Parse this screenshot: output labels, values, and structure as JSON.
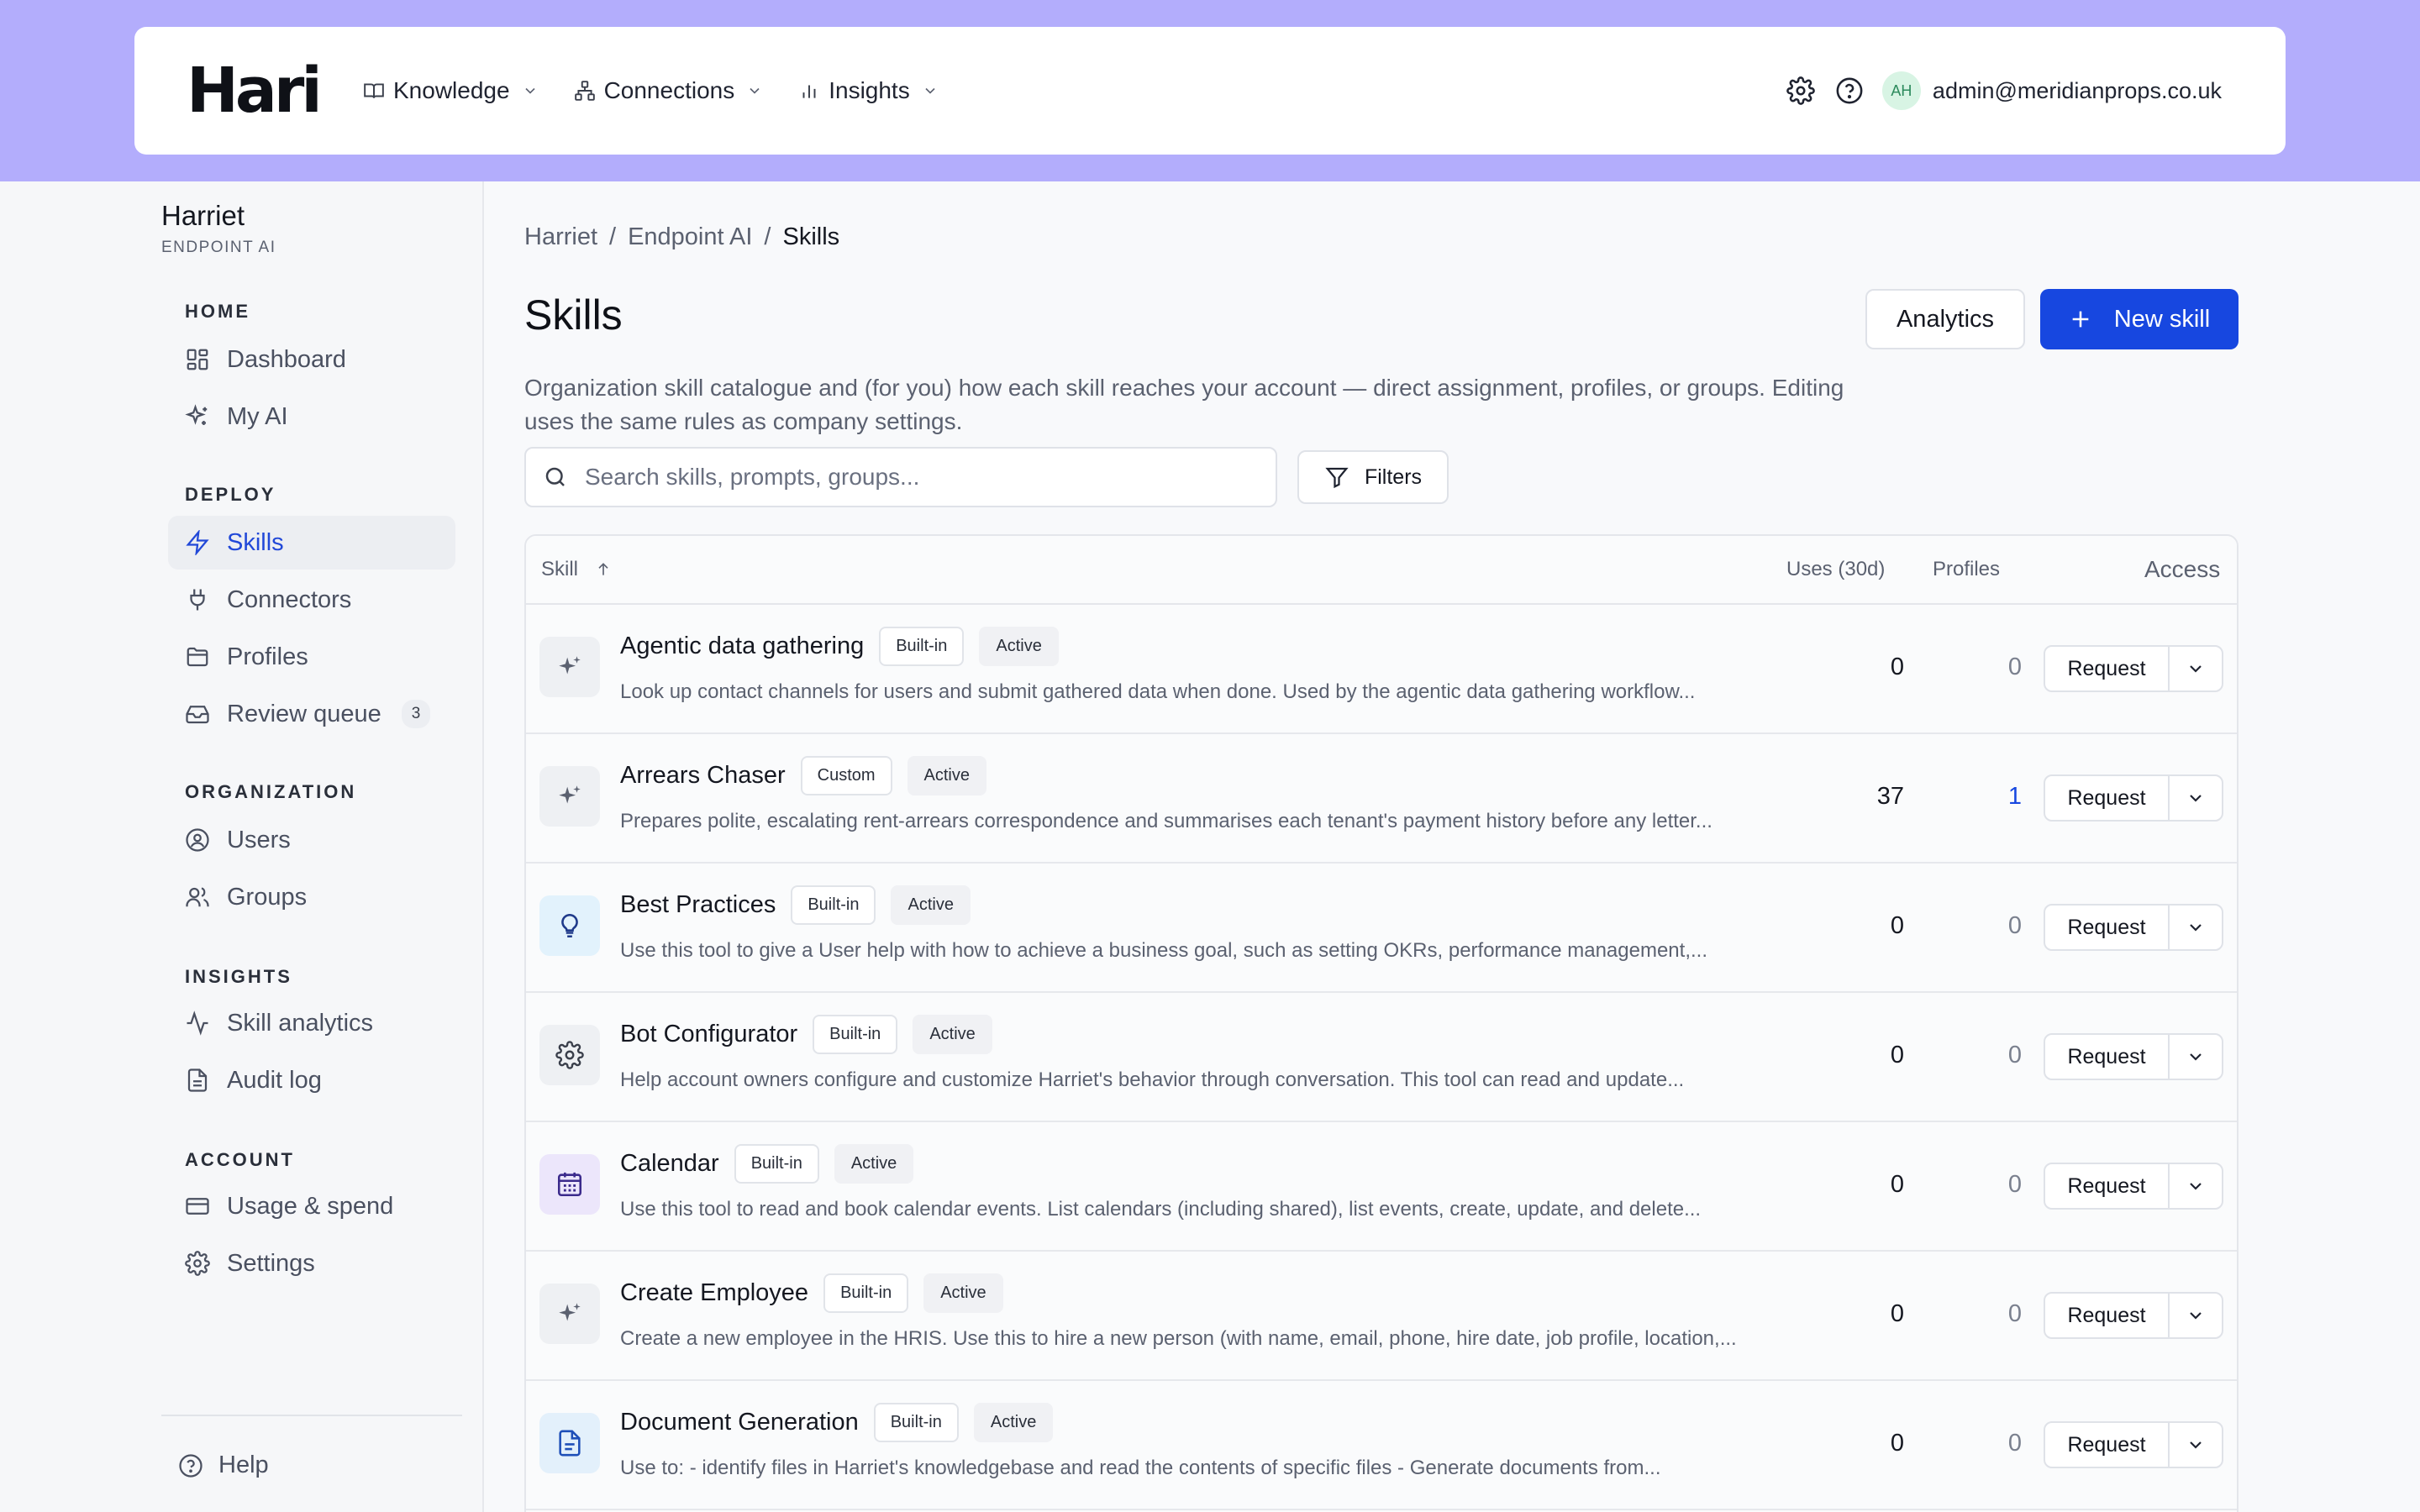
{
  "header": {
    "logo": "Hari",
    "nav": [
      {
        "label": "Knowledge",
        "icon": "book-icon"
      },
      {
        "label": "Connections",
        "icon": "network-icon"
      },
      {
        "label": "Insights",
        "icon": "bar-chart-icon"
      }
    ],
    "user": {
      "initials": "AH",
      "email": "admin@meridianprops.co.uk"
    }
  },
  "sidebar": {
    "org_name": "Harriet",
    "org_sub": "ENDPOINT AI",
    "sections": {
      "home": "HOME",
      "deploy": "DEPLOY",
      "organization": "ORGANIZATION",
      "insights": "INSIGHTS",
      "account": "ACCOUNT"
    },
    "items": {
      "dashboard": "Dashboard",
      "my_ai": "My AI",
      "skills": "Skills",
      "connectors": "Connectors",
      "profiles": "Profiles",
      "review_queue": "Review queue",
      "review_queue_count": "3",
      "users": "Users",
      "groups": "Groups",
      "skill_analytics": "Skill analytics",
      "audit_log": "Audit log",
      "usage_spend": "Usage & spend",
      "settings": "Settings"
    },
    "help": "Help"
  },
  "breadcrumb": [
    "Harriet",
    "Endpoint AI",
    "Skills"
  ],
  "page": {
    "title": "Skills",
    "analytics_label": "Analytics",
    "new_skill_label": "New skill",
    "description": "Organization skill catalogue and (for you) how each skill reaches your account — direct assignment, profiles, or groups. Editing uses the same rules as company settings.",
    "search_placeholder": "Search skills, prompts, groups...",
    "filters_label": "Filters"
  },
  "table": {
    "columns": {
      "skill": "Skill",
      "uses": "Uses (30d)",
      "profiles": "Profiles",
      "access": "Access"
    },
    "request_label": "Request",
    "rows": [
      {
        "icon": "sparkle-icon",
        "name": "Agentic data gathering",
        "type": "Built-in",
        "status": "Active",
        "desc": "Look up contact channels for users and submit gathered data when done. Used by the agentic data gathering workflow...",
        "uses": "0",
        "profiles": "0"
      },
      {
        "icon": "sparkle-icon",
        "name": "Arrears Chaser",
        "type": "Custom",
        "status": "Active",
        "desc": "Prepares polite, escalating rent-arrears correspondence and summarises each tenant's payment history before any letter...",
        "uses": "37",
        "profiles": "1"
      },
      {
        "icon": "lightbulb-icon",
        "name": "Best Practices",
        "type": "Built-in",
        "status": "Active",
        "desc": "Use this tool to give a User help with how to achieve a business goal, such as setting OKRs, performance management,...",
        "uses": "0",
        "profiles": "0"
      },
      {
        "icon": "gear-icon",
        "name": "Bot Configurator",
        "type": "Built-in",
        "status": "Active",
        "desc": "Help account owners configure and customize Harriet's behavior through conversation. This tool can read and update...",
        "uses": "0",
        "profiles": "0"
      },
      {
        "icon": "calendar-icon",
        "name": "Calendar",
        "type": "Built-in",
        "status": "Active",
        "desc": "Use this tool to read and book calendar events. List calendars (including shared), list events, create, update, and delete...",
        "uses": "0",
        "profiles": "0"
      },
      {
        "icon": "sparkle-icon",
        "name": "Create Employee",
        "type": "Built-in",
        "status": "Active",
        "desc": "Create a new employee in the HRIS. Use this to hire a new person (with name, email, phone, hire date, job profile, location,...",
        "uses": "0",
        "profiles": "0"
      },
      {
        "icon": "document-icon",
        "name": "Document Generation",
        "type": "Built-in",
        "status": "Active",
        "desc": "Use to: - identify files in Harriet's knowledgebase and read the contents of specific files - Generate documents from...",
        "uses": "0",
        "profiles": "0"
      }
    ]
  },
  "colors": {
    "top_band": "#b3adfc",
    "accent": "#1747e0",
    "avatar_bg": "#d8f4e4"
  }
}
